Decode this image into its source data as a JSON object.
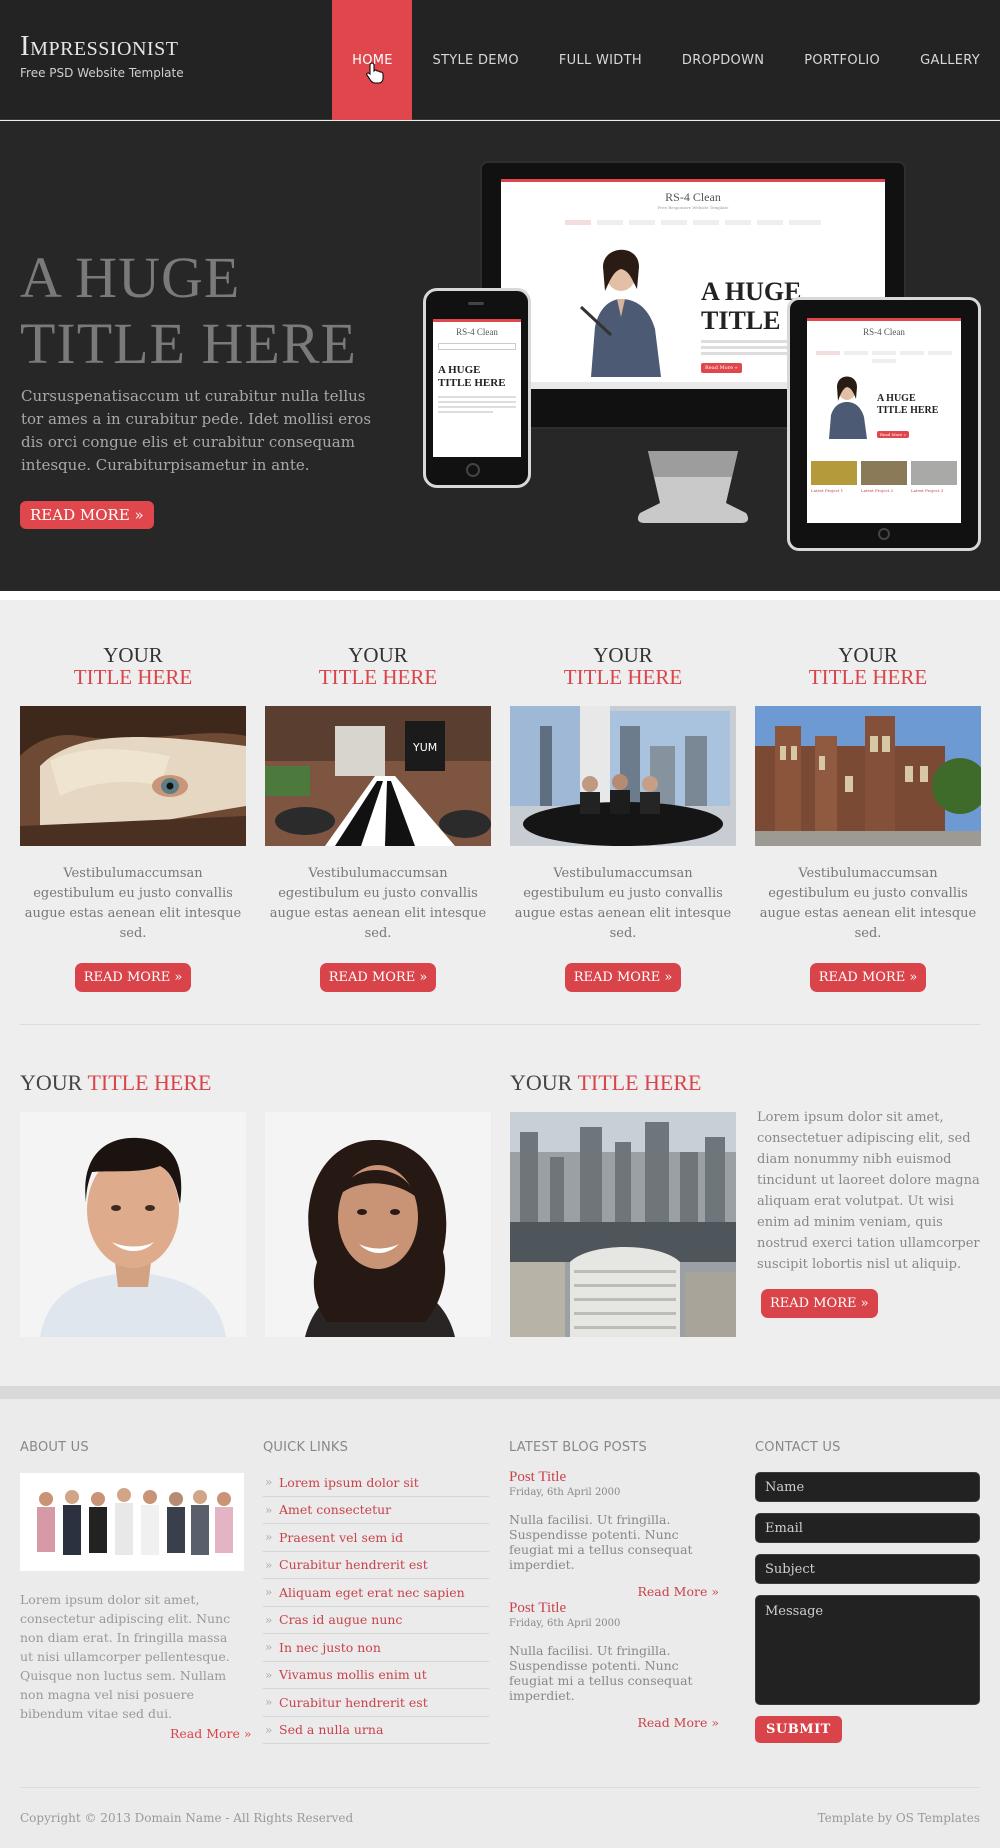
{
  "header": {
    "brand": "Impressionist",
    "tagline": "Free PSD Website Template",
    "nav": [
      "HOME",
      "STYLE DEMO",
      "FULL WIDTH",
      "DROPDOWN",
      "PORTFOLIO",
      "GALLERY"
    ],
    "active_nav": "HOME"
  },
  "hero": {
    "title_line1": "A HUGE",
    "title_line2": "TITLE HERE",
    "text": "Cursuspenatisaccum ut curabitur nulla tellus tor ames a in curabitur pede. Idet mollisi eros dis orci congue elis et curabitur consequam intesque. Curabiturpisametur in ante.",
    "button": "READ MORE »",
    "devices": {
      "site_name": "RS-4 Clean",
      "site_tagline": "Free Responsive Website Template",
      "mini_title_line1": "A HUGE",
      "mini_title_line2": "TITLE HERE",
      "mini_button": "Read More »",
      "tablet_thumbs": [
        "Latest Project 1",
        "Latest Project 2",
        "Latest Project 3"
      ]
    }
  },
  "features": [
    {
      "title_a": "YOUR",
      "title_b": "TITLE HERE",
      "text": "Vestibulumaccumsan egestibulum eu justo convallis augue estas aenean elit intesque sed.",
      "button": "READ MORE »",
      "image": "woman-eye-photo"
    },
    {
      "title_a": "YOUR",
      "title_b": "TITLE HERE",
      "text": "Vestibulumaccumsan egestibulum eu justo convallis augue estas aenean elit intesque sed.",
      "button": "READ MORE »",
      "image": "restaurant-photo"
    },
    {
      "title_a": "YOUR",
      "title_b": "TITLE HERE",
      "text": "Vestibulumaccumsan egestibulum eu justo convallis augue estas aenean elit intesque sed.",
      "button": "READ MORE »",
      "image": "office-meeting-photo"
    },
    {
      "title_a": "YOUR",
      "title_b": "TITLE HERE",
      "text": "Vestibulumaccumsan egestibulum eu justo convallis augue estas aenean elit intesque sed.",
      "button": "READ MORE »",
      "image": "college-building-photo"
    }
  ],
  "section_left": {
    "title_a": "YOUR ",
    "title_b": "TITLE HERE"
  },
  "section_right": {
    "title_a": "YOUR ",
    "title_b": "TITLE HERE",
    "text": "Lorem ipsum dolor sit amet, consectetuer adipiscing elit, sed diam nonummy nibh euismod tincidunt ut laoreet dolore magna aliquam erat volutpat. Ut wisi enim ad minim veniam, quis nostrud exerci tation ullamcorper suscipit lobortis nisl ut aliquip.",
    "button": "READ MORE »"
  },
  "footer": {
    "about": {
      "heading": "ABOUT US",
      "text": "Lorem ipsum dolor sit amet, consectetur adipiscing elit. Nunc non diam erat. In fringilla massa ut nisi ullamcorper pellentesque. Quisque non luctus sem. Nullam non magna vel nisi posuere bibendum vitae sed dui.",
      "more": "Read More »"
    },
    "links": {
      "heading": "QUICK LINKS",
      "items": [
        "Lorem ipsum dolor sit",
        "Amet consectetur",
        "Praesent vel sem id",
        "Curabitur hendrerit est",
        "Aliquam eget erat nec sapien",
        "Cras id augue nunc",
        "In nec justo non",
        "Vivamus mollis enim ut",
        "Curabitur hendrerit est",
        "Sed a nulla urna"
      ]
    },
    "blog": {
      "heading": "LATEST BLOG POSTS",
      "posts": [
        {
          "title": "Post Title",
          "date": "Friday, 6th April 2000",
          "text": "Nulla facilisi. Ut fringilla. Suspendisse potenti. Nunc feugiat mi a tellus consequat imperdiet.",
          "more": "Read More »"
        },
        {
          "title": "Post Title",
          "date": "Friday, 6th April 2000",
          "text": "Nulla facilisi. Ut fringilla. Suspendisse potenti. Nunc feugiat mi a tellus consequat imperdiet.",
          "more": "Read More »"
        }
      ]
    },
    "contact": {
      "heading": "CONTACT US",
      "name_placeholder": "Name",
      "email_placeholder": "Email",
      "subject_placeholder": "Subject",
      "message_placeholder": "Message",
      "submit": "SUBMIT"
    },
    "copyright": "Copyright © 2013 Domain Name - All Rights Reserved",
    "credit": "Template by OS Templates"
  },
  "colors": {
    "accent": "#d9444a",
    "header_bg": "#232323",
    "hero_bg": "#272727"
  }
}
